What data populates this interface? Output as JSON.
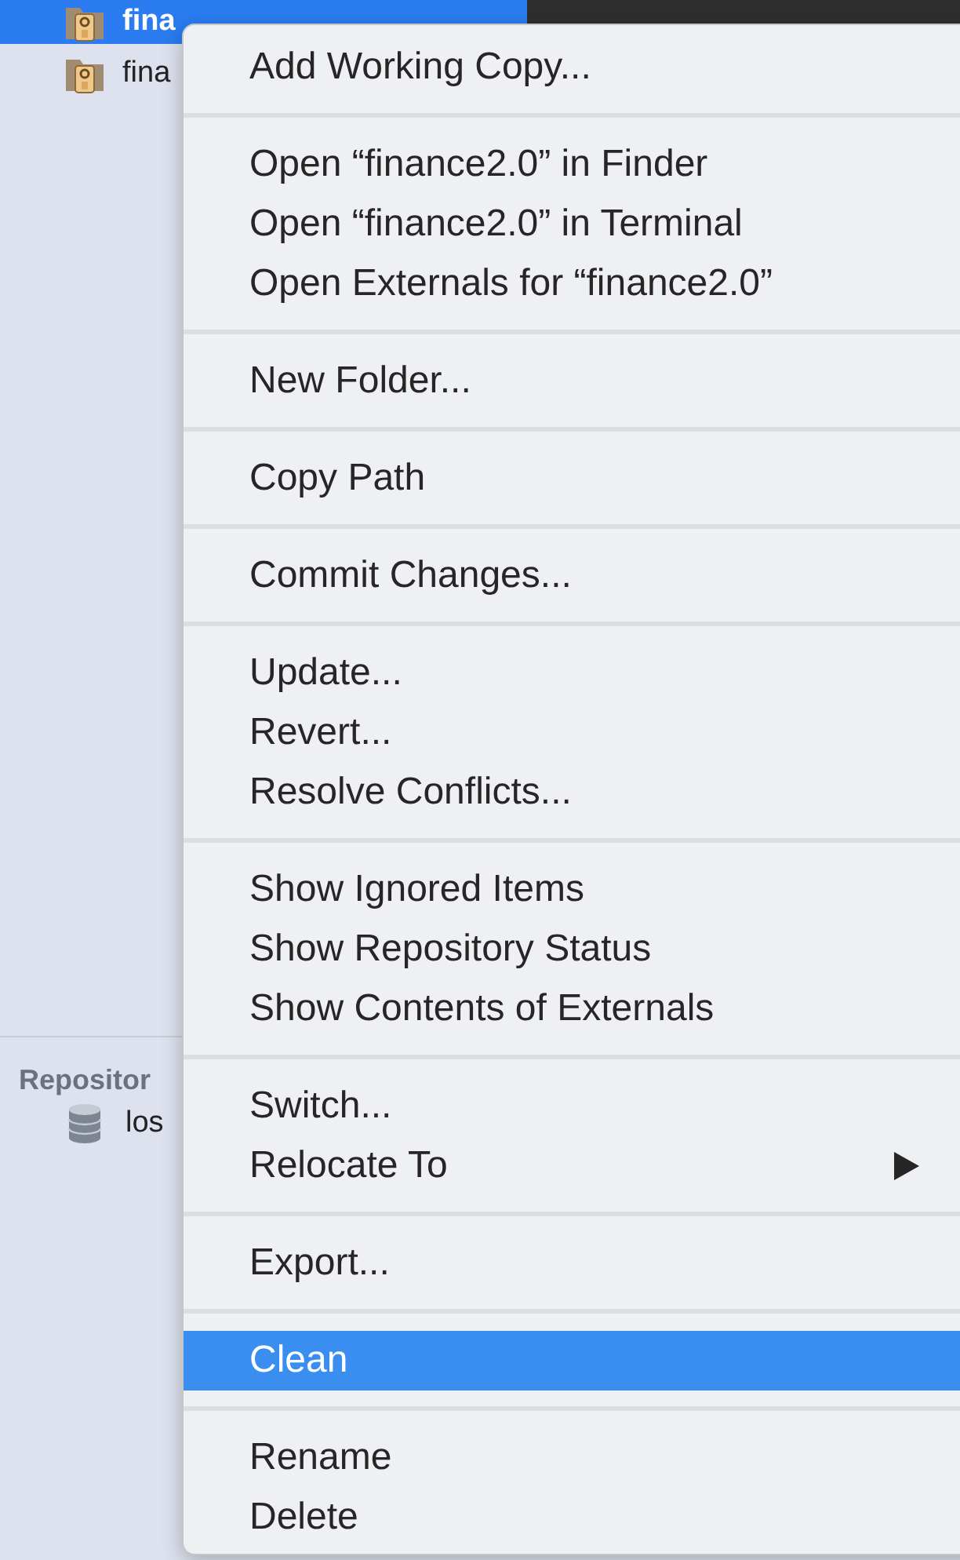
{
  "sidebar": {
    "working_copies": [
      {
        "label": "fina",
        "selected": true
      },
      {
        "label": "fina",
        "selected": false
      }
    ],
    "repositories": {
      "header": "Repositor",
      "items": [
        {
          "label": "los"
        }
      ]
    }
  },
  "context_menu": {
    "sections": [
      [
        {
          "label": "Add Working Copy...",
          "selected": false,
          "submenu": false
        }
      ],
      [
        {
          "label": "Open “finance2.0” in Finder",
          "selected": false,
          "submenu": false
        },
        {
          "label": "Open “finance2.0” in Terminal",
          "selected": false,
          "submenu": false
        },
        {
          "label": "Open Externals for “finance2.0”",
          "selected": false,
          "submenu": false
        }
      ],
      [
        {
          "label": "New Folder...",
          "selected": false,
          "submenu": false
        }
      ],
      [
        {
          "label": "Copy Path",
          "selected": false,
          "submenu": false
        }
      ],
      [
        {
          "label": "Commit Changes...",
          "selected": false,
          "submenu": false
        }
      ],
      [
        {
          "label": "Update...",
          "selected": false,
          "submenu": false
        },
        {
          "label": "Revert...",
          "selected": false,
          "submenu": false
        },
        {
          "label": "Resolve Conflicts...",
          "selected": false,
          "submenu": false
        }
      ],
      [
        {
          "label": "Show Ignored Items",
          "selected": false,
          "submenu": false
        },
        {
          "label": "Show Repository Status",
          "selected": false,
          "submenu": false
        },
        {
          "label": "Show Contents of Externals",
          "selected": false,
          "submenu": false
        }
      ],
      [
        {
          "label": "Switch...",
          "selected": false,
          "submenu": false
        },
        {
          "label": "Relocate To",
          "selected": false,
          "submenu": true
        }
      ],
      [
        {
          "label": "Export...",
          "selected": false,
          "submenu": false
        }
      ],
      [
        {
          "label": "Clean",
          "selected": true,
          "submenu": false
        }
      ],
      [
        {
          "label": "Rename",
          "selected": false,
          "submenu": false
        },
        {
          "label": "Delete",
          "selected": false,
          "submenu": false
        }
      ]
    ]
  }
}
